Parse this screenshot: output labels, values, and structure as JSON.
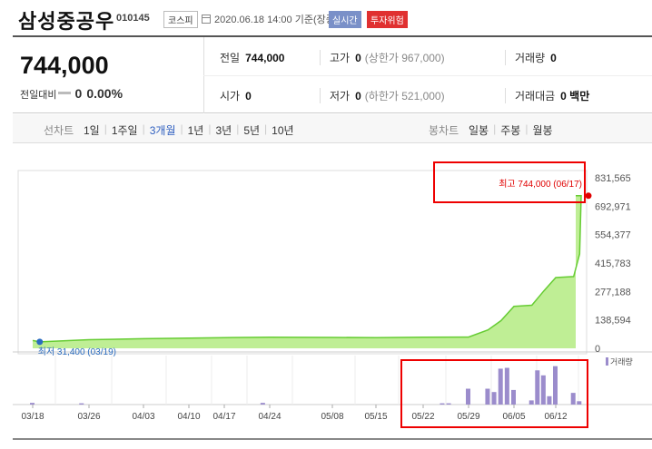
{
  "stock": {
    "name": "삼성중공우",
    "code": "010145",
    "market": "코스피",
    "date": "2020.06.18 14:00",
    "basis": "기준(장중)",
    "badge_realtime": "실시간",
    "badge_risk": "투자위험"
  },
  "summary": {
    "price": "744,000",
    "change_label": "전일대비",
    "change_value": "0",
    "change_rate": "0.00%",
    "prev_close_label": "전일",
    "prev_close": "744,000",
    "high_label": "고가",
    "high": "0",
    "high_sub": "(상한가 967,000)",
    "volume_label": "거래량",
    "volume": "0",
    "open_label": "시가",
    "open": "0",
    "low_label": "저가",
    "low": "0",
    "low_sub": "(하한가 521,000)",
    "amount_label": "거래대금",
    "amount": "0 백만"
  },
  "period": {
    "label": "선차트",
    "tabs": [
      "1일",
      "1주일",
      "3개월",
      "1년",
      "3년",
      "5년",
      "10년"
    ],
    "active": "3개월"
  },
  "candle": {
    "label": "봉차트",
    "tabs": [
      "일봉",
      "주봉",
      "월봉"
    ]
  },
  "chart": {
    "max_label": "최고 744,000 (06/17)",
    "min_label": "최저 31,400 (03/19)",
    "volume_legend": "거래량",
    "colors": {
      "line": "#66cc33",
      "fill": "#b8ec8a",
      "bar": "#9b8ccc",
      "max": "#e00000",
      "min": "#2a6cc0"
    }
  },
  "chart_data": {
    "type": "area",
    "y_ticks": [
      "831,565",
      "692,971",
      "554,377",
      "415,783",
      "277,188",
      "138,594",
      "0"
    ],
    "ylim": [
      0,
      831565
    ],
    "x_ticks": [
      "03/18",
      "03/26",
      "04/03",
      "04/10",
      "04/17",
      "04/24",
      "05/08",
      "05/15",
      "05/22",
      "05/29",
      "06/05",
      "06/12"
    ],
    "price_series": {
      "x": [
        "03/18",
        "03/19",
        "03/26",
        "04/03",
        "04/10",
        "04/17",
        "04/24",
        "05/08",
        "05/15",
        "05/22",
        "05/29",
        "06/01",
        "06/03",
        "06/05",
        "06/08",
        "06/10",
        "06/12",
        "06/15",
        "06/16",
        "06/17",
        "06/18"
      ],
      "values": [
        38000,
        31400,
        42000,
        47000,
        50000,
        52000,
        54000,
        53000,
        52000,
        54000,
        55000,
        90000,
        135000,
        205000,
        210000,
        280000,
        345000,
        350000,
        460000,
        744000,
        744000
      ]
    },
    "volume_series": {
      "x": [
        "03/18",
        "03/25",
        "04/23",
        "05/25",
        "05/26",
        "05/29",
        "06/01",
        "06/02",
        "06/03",
        "06/04",
        "06/05",
        "06/08",
        "06/09",
        "06/10",
        "06/11",
        "06/12",
        "06/15",
        "06/16"
      ],
      "values": [
        4,
        3,
        4,
        3,
        3,
        38,
        38,
        30,
        86,
        88,
        35,
        10,
        82,
        70,
        20,
        92,
        28,
        8
      ]
    }
  }
}
